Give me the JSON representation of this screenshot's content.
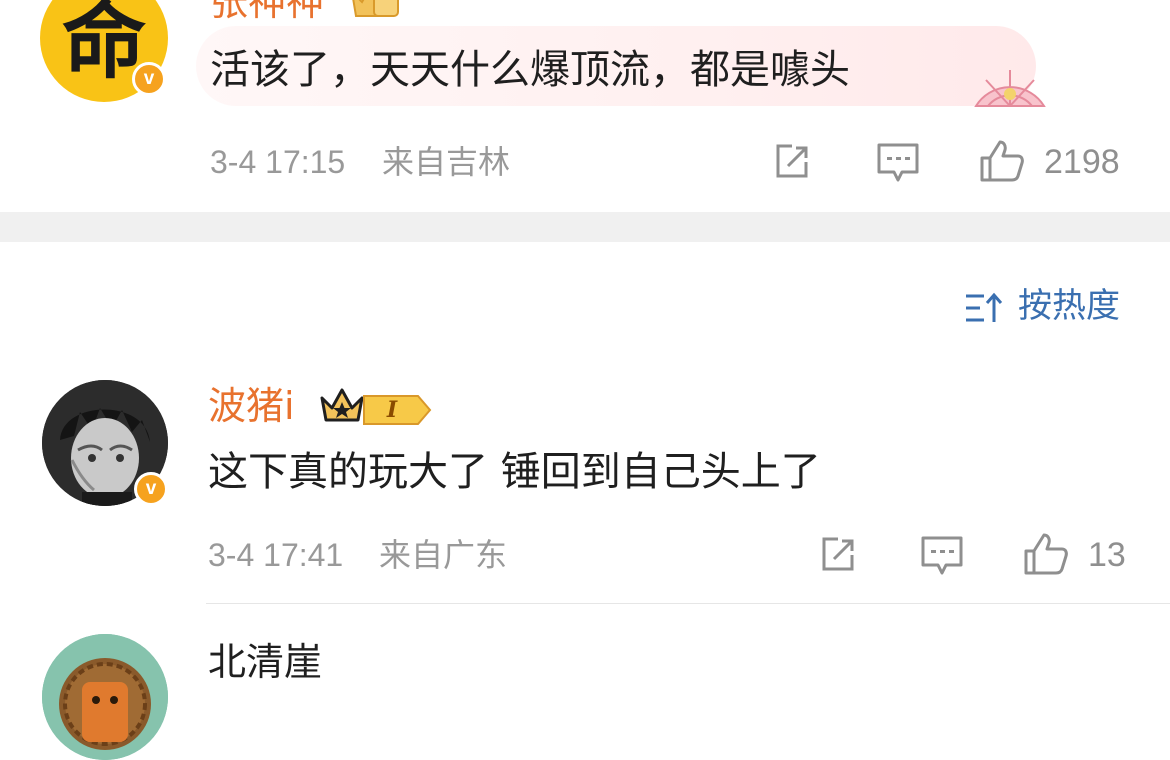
{
  "comment1": {
    "avatar_text": "命",
    "username": "张神神",
    "text": "活该了，天天什么爆顶流，都是噱头",
    "time": "3-4 17:15",
    "location": "来自吉林",
    "likes": "2198",
    "verified_mark": "v"
  },
  "sort": {
    "label": "按热度",
    "icon": "sort-icon"
  },
  "comment2": {
    "username": "波猪i",
    "level": "I",
    "text": "这下真的玩大了 锤回到自己头上了",
    "time": "3-4 17:41",
    "location": "来自广东",
    "likes": "13",
    "verified_mark": "v"
  },
  "comment3": {
    "username": "北清崖"
  },
  "colors": {
    "username_vip": "#e8722e",
    "meta_gray": "#999999",
    "sort_blue": "#3a6fb0",
    "badge_orange": "#f6a21e"
  }
}
